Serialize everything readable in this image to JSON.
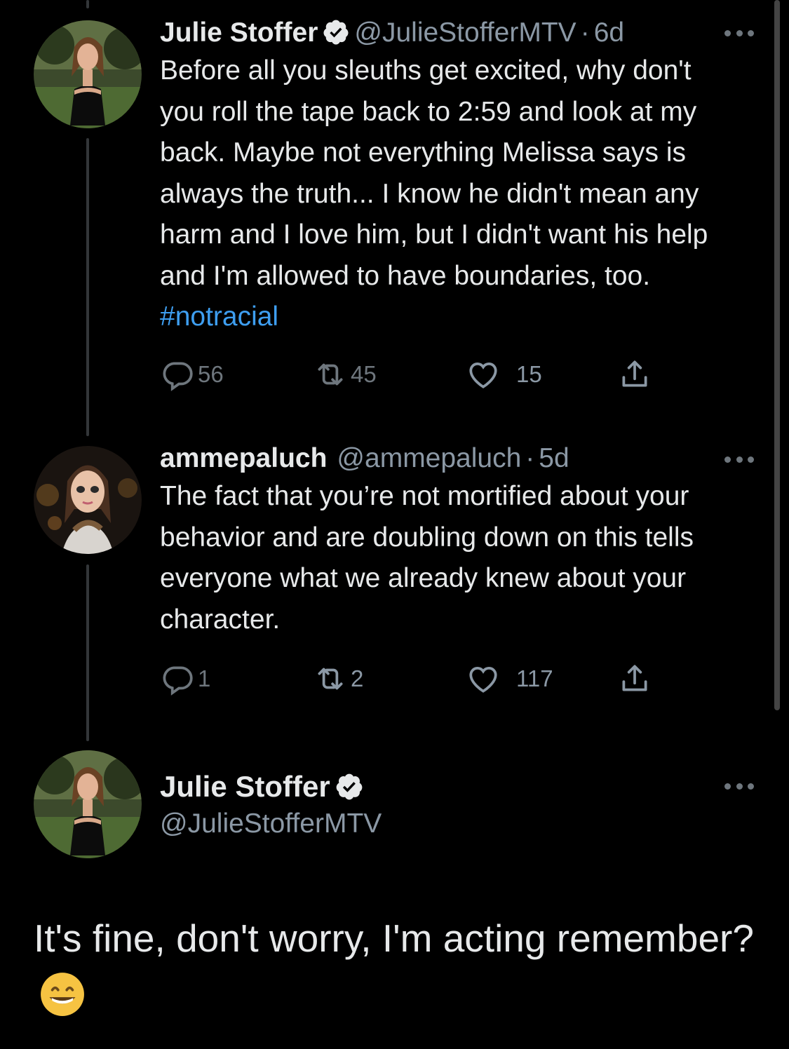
{
  "tweets": [
    {
      "display_name": "Julie Stoffer",
      "handle": "@JulieStofferMTV",
      "separator": "·",
      "time": "6d",
      "verified": true,
      "text": "Before all you sleuths get excited, why don't you roll the tape back to 2:59 and look at my back. Maybe not everything Melissa says is always the truth... I know he didn't mean any harm and I love him, but I didn't want his help and I'm allowed to have boundaries, too. ",
      "hashtag": "#notracial",
      "replies": "56",
      "retweets": "45",
      "likes": "15"
    },
    {
      "display_name": "ammepaluch",
      "handle": "@ammepaluch",
      "separator": "·",
      "time": "5d",
      "verified": false,
      "text": "The fact that you’re not mortified about your behavior and are doubling down on this tells everyone what we already knew about your character.",
      "replies": "1",
      "retweets": "2",
      "likes": "117"
    }
  ],
  "focus_tweet": {
    "display_name": "Julie Stoffer",
    "handle": "@JulieStofferMTV",
    "verified": true,
    "text": "It's fine, don't worry, I'm acting remember?",
    "emoji": "grinning-face-with-smiling-eyes"
  },
  "colors": {
    "background": "#000000",
    "text": "#e7e9ea",
    "secondary": "#8b98a5",
    "link": "#3e9ef0",
    "thread_line": "#333639"
  },
  "icons": {
    "reply": "reply-icon",
    "retweet": "retweet-icon",
    "like": "heart-icon",
    "share": "share-icon",
    "verified": "verified-badge-icon",
    "more": "more-icon"
  }
}
